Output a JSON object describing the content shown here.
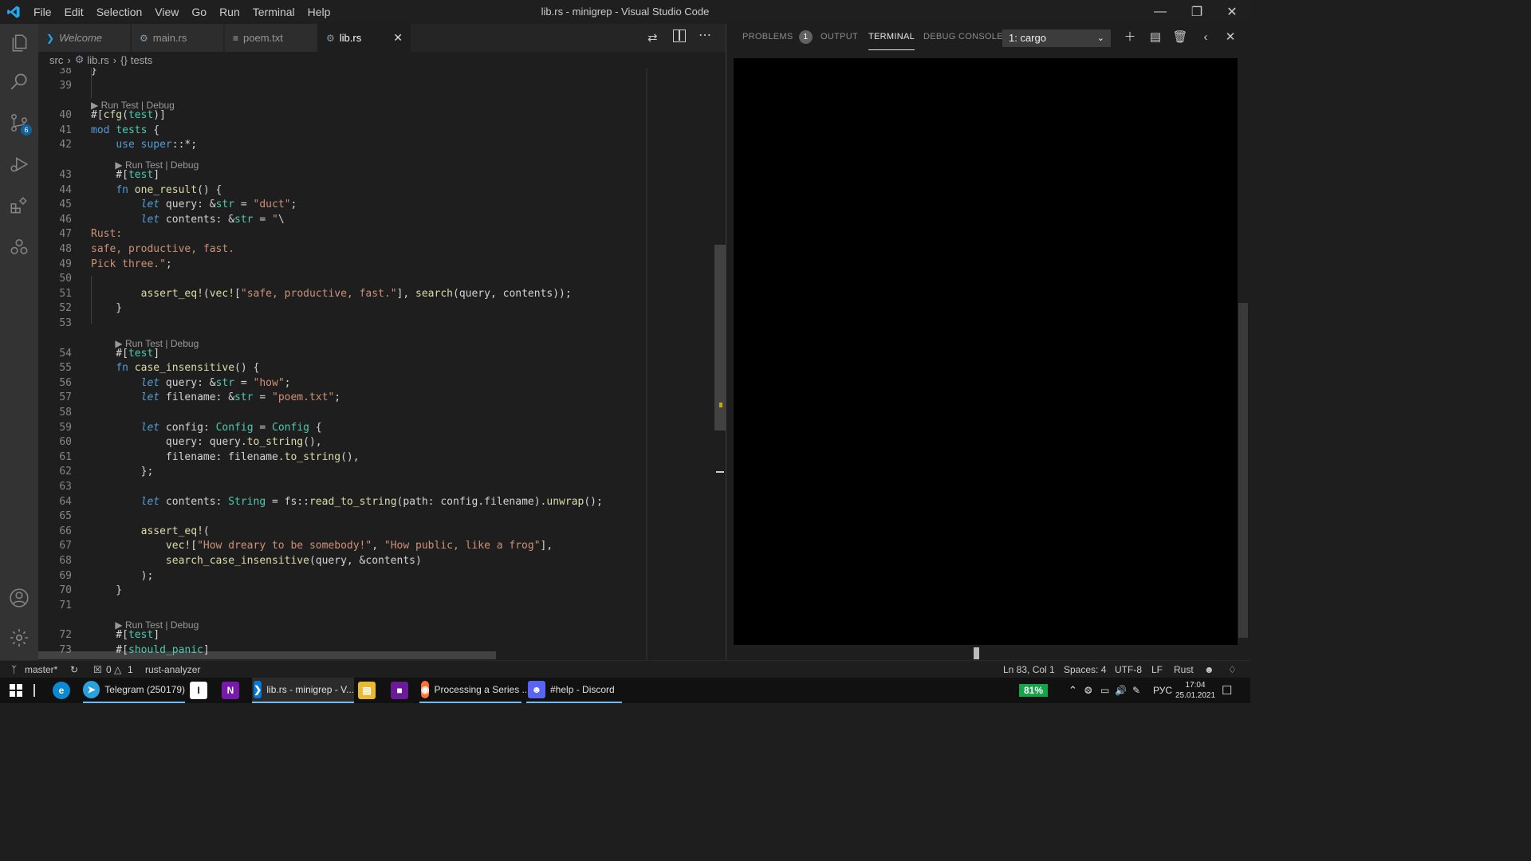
{
  "window": {
    "title": "lib.rs - minigrep - Visual Studio Code"
  },
  "menu": [
    "File",
    "Edit",
    "Selection",
    "View",
    "Go",
    "Run",
    "Terminal",
    "Help"
  ],
  "tabs": [
    {
      "label": "Welcome",
      "icon": "vscode-icon"
    },
    {
      "label": "main.rs",
      "icon": "rust-icon"
    },
    {
      "label": "poem.txt",
      "icon": "text-file-icon"
    },
    {
      "label": "lib.rs",
      "icon": "rust-icon",
      "active": true
    }
  ],
  "breadcrumb": {
    "folder": "src",
    "file": "lib.rs",
    "symbol": "tests",
    "symbol_icon": "{}"
  },
  "activity": {
    "scm_badge": "6"
  },
  "code_lens": "▶ Run Test | Debug",
  "lines": [
    {
      "n": "38",
      "t": "}"
    },
    {
      "n": "39",
      "t": ""
    },
    {
      "n": "40",
      "t": "#[cfg(test)]"
    },
    {
      "n": "41",
      "t": "mod tests {"
    },
    {
      "n": "42",
      "t": "    use super::*;"
    },
    {
      "n": "43",
      "t": "    #[test]"
    },
    {
      "n": "44",
      "t": "    fn one_result() {"
    },
    {
      "n": "45",
      "t": "        let query: &str = \"duct\";"
    },
    {
      "n": "46",
      "t": "        let contents: &str = \"\\"
    },
    {
      "n": "47",
      "t": "Rust:"
    },
    {
      "n": "48",
      "t": "safe, productive, fast."
    },
    {
      "n": "49",
      "t": "Pick three.\";"
    },
    {
      "n": "50",
      "t": ""
    },
    {
      "n": "51",
      "t": "        assert_eq!(vec![\"safe, productive, fast.\"], search(query, contents));"
    },
    {
      "n": "52",
      "t": "    }"
    },
    {
      "n": "53",
      "t": ""
    },
    {
      "n": "54",
      "t": "    #[test]"
    },
    {
      "n": "55",
      "t": "    fn case_insensitive() {"
    },
    {
      "n": "56",
      "t": "        let query: &str = \"how\";"
    },
    {
      "n": "57",
      "t": "        let filename: &str = \"poem.txt\";"
    },
    {
      "n": "58",
      "t": ""
    },
    {
      "n": "59",
      "t": "        let config: Config = Config {"
    },
    {
      "n": "60",
      "t": "            query: query.to_string(),"
    },
    {
      "n": "61",
      "t": "            filename: filename.to_string(),"
    },
    {
      "n": "62",
      "t": "        };"
    },
    {
      "n": "63",
      "t": ""
    },
    {
      "n": "64",
      "t": "        let contents: String = fs::read_to_string(path: config.filename).unwrap();"
    },
    {
      "n": "65",
      "t": ""
    },
    {
      "n": "66",
      "t": "        assert_eq!("
    },
    {
      "n": "67",
      "t": "            vec![\"How dreary to be somebody!\", \"How public, like a frog\"],"
    },
    {
      "n": "68",
      "t": "            search_case_insensitive(query, &contents)"
    },
    {
      "n": "69",
      "t": "        );"
    },
    {
      "n": "70",
      "t": "    }"
    },
    {
      "n": "71",
      "t": ""
    },
    {
      "n": "72",
      "t": "    #[test]"
    },
    {
      "n": "73",
      "t": "    #[should_panic]"
    }
  ],
  "panel": {
    "tabs": [
      {
        "label": "PROBLEMS",
        "badge": "1"
      },
      {
        "label": "OUTPUT"
      },
      {
        "label": "TERMINAL",
        "active": true
      },
      {
        "label": "DEBUG CONSOLE"
      }
    ],
    "terminal_select": "1: cargo"
  },
  "status": {
    "branch": "master*",
    "errors": "0",
    "warnings": "1",
    "extension": "rust-analyzer",
    "position": "Ln 83, Col 1",
    "spaces": "Spaces: 4",
    "encoding": "UTF-8",
    "eol": "LF",
    "language": "Rust"
  },
  "taskbar": {
    "items": [
      {
        "label": "Telegram (250179)",
        "color": "#2aa1da"
      },
      {
        "label": "lib.rs - minigrep - V...",
        "color": "#0078d4"
      },
      {
        "label": "Processing a Series ...",
        "color": "#ff7139"
      },
      {
        "label": "#help - Discord",
        "color": "#5865f2"
      }
    ],
    "battery": "81%",
    "lang": "РУС",
    "time": "17:04",
    "date": "25.01.2021"
  }
}
